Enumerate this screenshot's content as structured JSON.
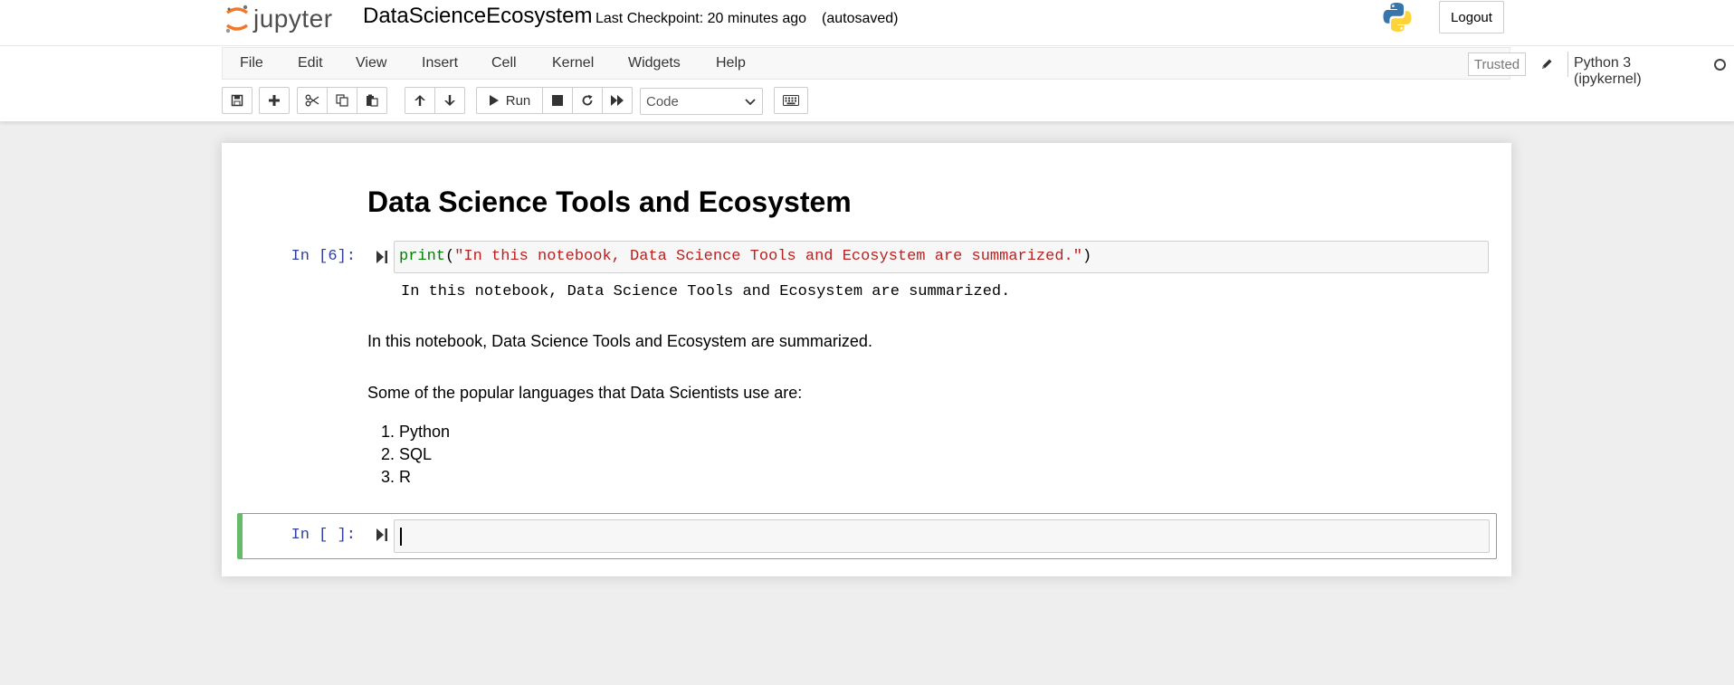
{
  "header": {
    "logo_text": "jupyter",
    "notebook_name": "DataScienceEcosystem",
    "checkpoint": "Last Checkpoint: 20 minutes ago",
    "autosave": "(autosaved)",
    "logout_label": "Logout"
  },
  "menu": {
    "items": [
      "File",
      "Edit",
      "View",
      "Insert",
      "Cell",
      "Kernel",
      "Widgets",
      "Help"
    ],
    "trusted_label": "Trusted",
    "kernel_name": "Python 3 (ipykernel)"
  },
  "toolbar": {
    "run_label": "Run",
    "cell_type": "Code"
  },
  "notebook": {
    "title": "Data Science Tools and Ecosystem",
    "code_cell": {
      "prompt": "In [6]:",
      "code_func": "print",
      "code_open": "(",
      "code_string": "\"In this notebook, Data Science Tools and Ecosystem are summarized.\"",
      "code_close": ")",
      "output": "In this notebook, Data Science Tools and Ecosystem are summarized."
    },
    "markdown_intro": "In this notebook, Data Science Tools and Ecosystem are summarized.",
    "languages_intro": "Some of the popular languages that Data Scientists use are:",
    "languages": [
      "1. Python",
      "2. SQL",
      "3. R"
    ],
    "empty_cell_prompt": "In [ ]:"
  },
  "colors": {
    "prompt": "#303f9f",
    "selected_border": "#66bb6a",
    "string": "#ba2121",
    "builtin": "#008000"
  }
}
